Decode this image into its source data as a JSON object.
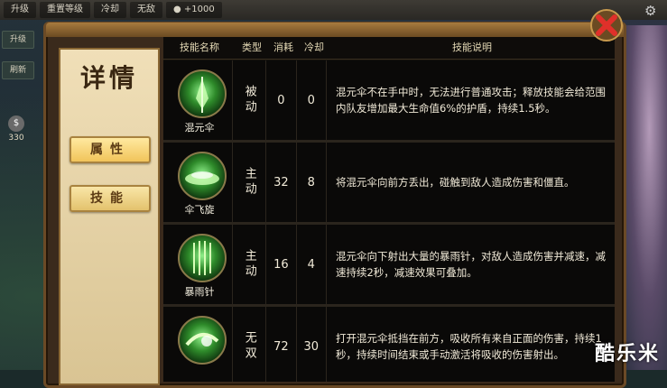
{
  "top_bar": {
    "buttons": [
      "升级",
      "重置等级",
      "冷却",
      "无敌"
    ],
    "coins": "+1000"
  },
  "left_strip": {
    "buttons": [
      "升级",
      "刷新"
    ],
    "coin_count": "330"
  },
  "panel": {
    "title": "详情",
    "tabs": [
      {
        "label": "属性",
        "active": true
      },
      {
        "label": "技能",
        "active": false
      }
    ]
  },
  "table": {
    "headers": [
      "技能名称",
      "类型",
      "消耗",
      "冷却",
      "技能说明"
    ],
    "rows": [
      {
        "name": "混元伞",
        "type": "被动",
        "cost": "0",
        "cooldown": "0",
        "description": "混元伞不在手中时，无法进行普通攻击；释放技能会给范围内队友增加最大生命值6%的护盾，持续1.5秒。",
        "icon": "umbrella-icon"
      },
      {
        "name": "伞飞旋",
        "type": "主动",
        "cost": "32",
        "cooldown": "8",
        "description": "将混元伞向前方丢出，碰触到敌人造成伤害和僵直。",
        "icon": "spinning-umbrella-icon"
      },
      {
        "name": "暴雨针",
        "type": "主动",
        "cost": "16",
        "cooldown": "4",
        "description": "混元伞向下射出大量的暴雨针，对敌人造成伤害并减速，减速持续2秒，减速效果可叠加。",
        "icon": "needle-rain-icon"
      },
      {
        "name": "",
        "type": "无双",
        "cost": "72",
        "cooldown": "30",
        "description": "打开混元伞抵挡在前方，吸收所有来自正面的伤害，持续1秒，持续时间结束或手动激活将吸收的伤害射出。",
        "icon": "shield-umbrella-icon"
      }
    ]
  },
  "watermark": "酷乐米",
  "colors": {
    "accent": "#e3c26d",
    "close": "#e0302a",
    "panel_bg": "#14110d"
  }
}
